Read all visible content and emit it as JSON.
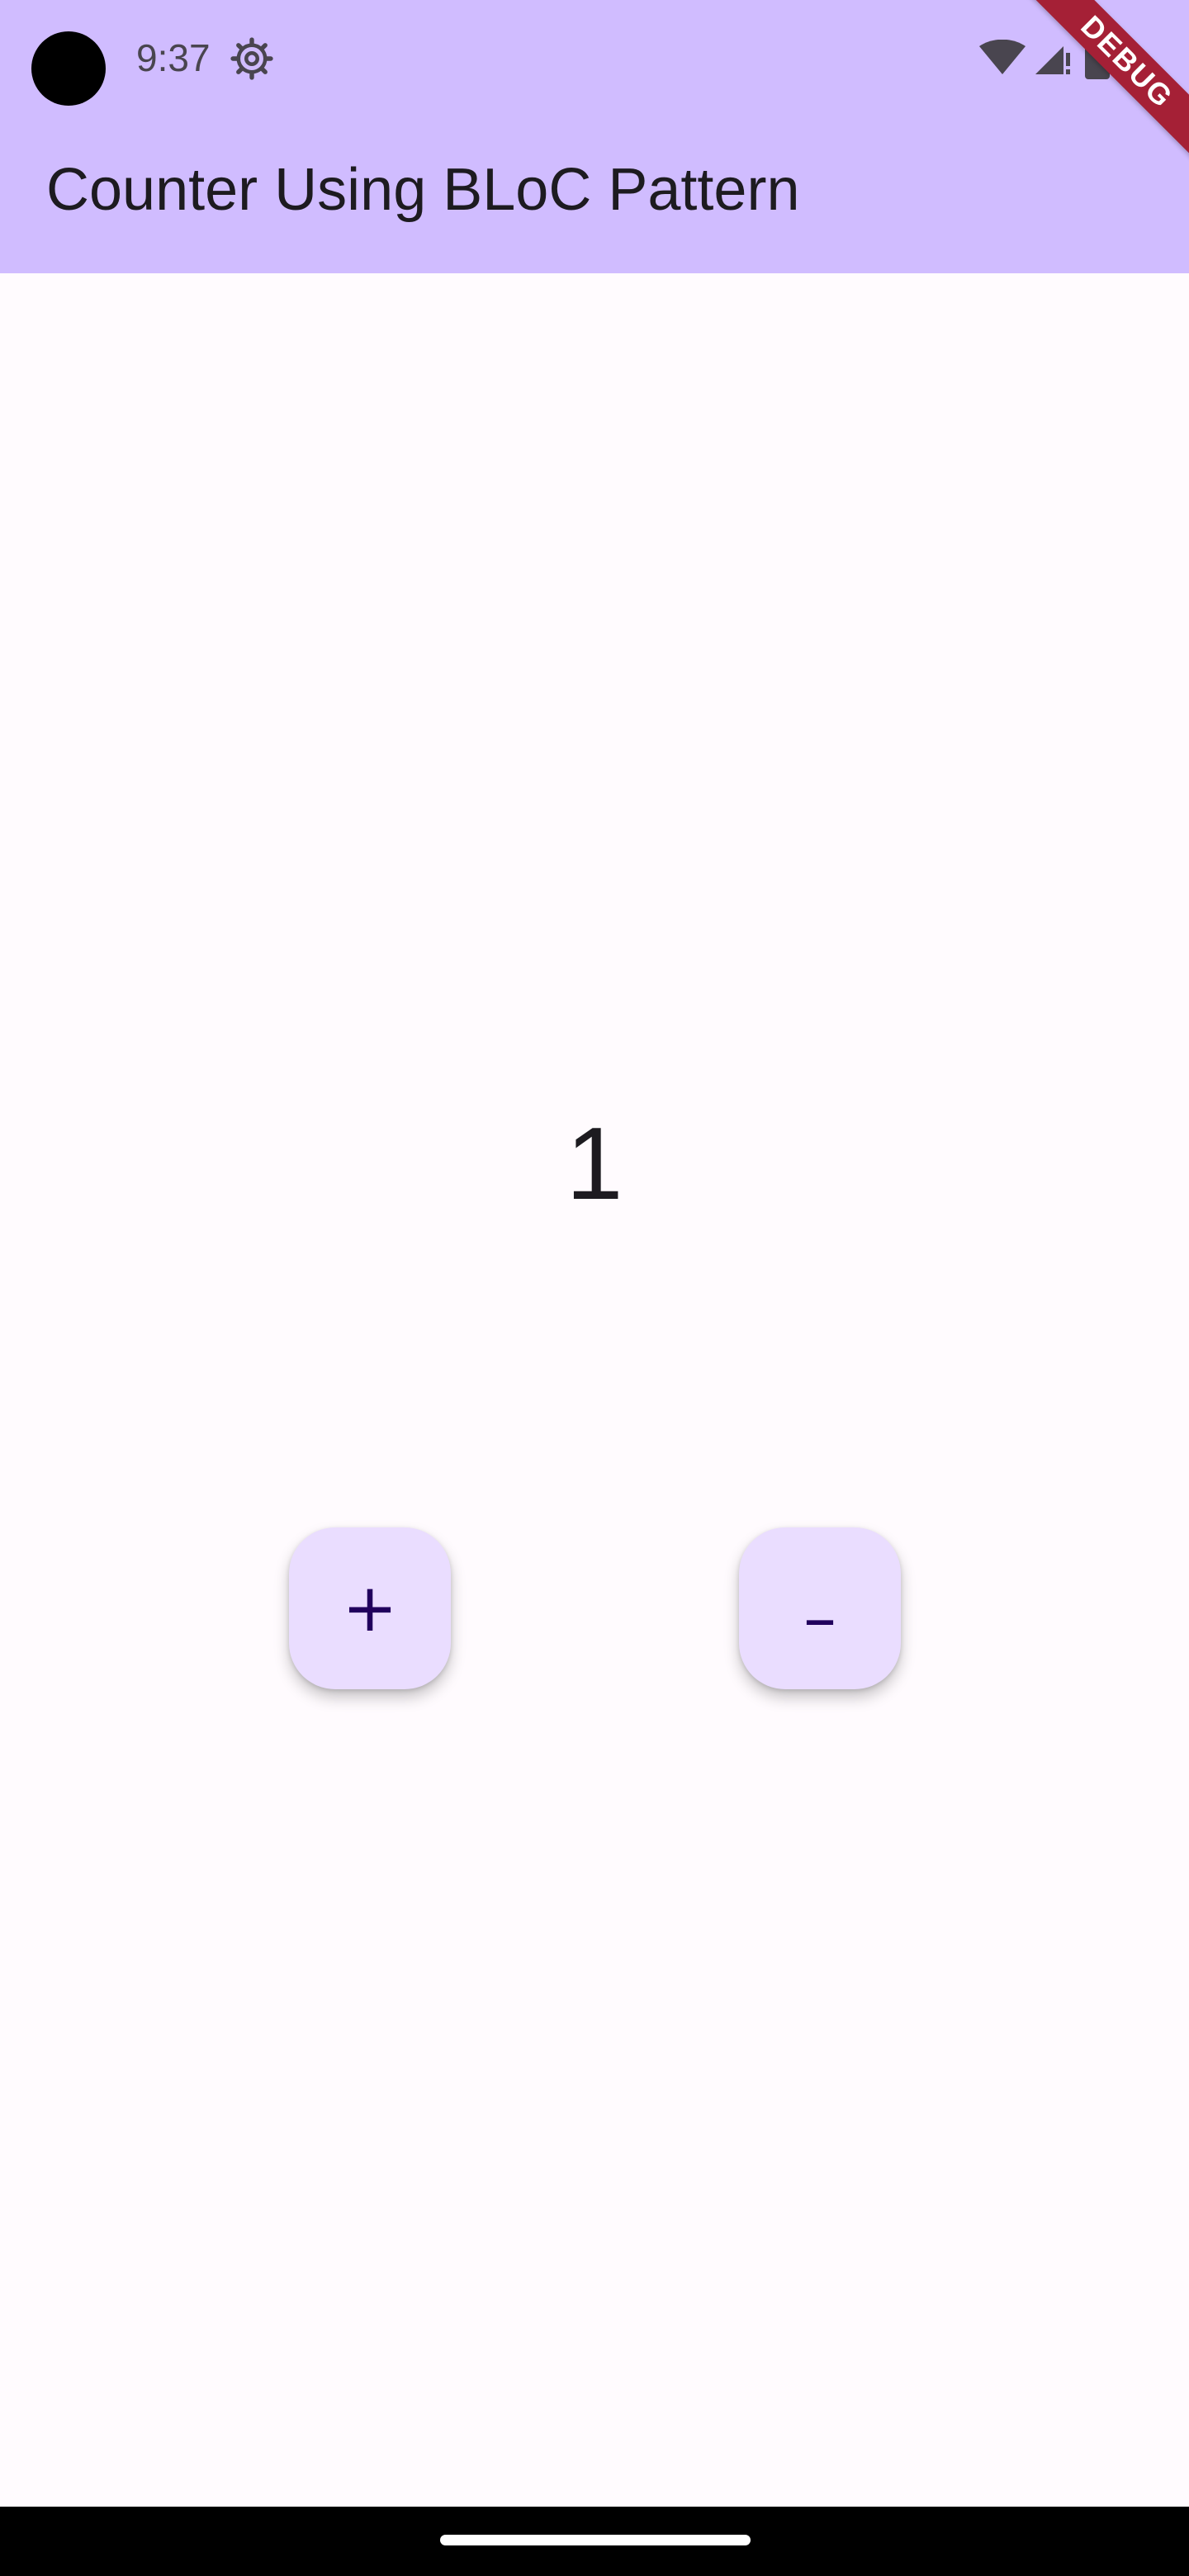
{
  "status_bar": {
    "time": "9:37",
    "icons": [
      "settings-gear-icon",
      "wifi-icon",
      "cellular-signal-icon",
      "battery-icon"
    ]
  },
  "debug_banner": {
    "label": "DEBUG"
  },
  "app_bar": {
    "title": "Counter Using BLoC Pattern"
  },
  "counter": {
    "value": "1"
  },
  "buttons": {
    "increment_label": "+",
    "decrement_label": "–"
  },
  "colors": {
    "app_bar_bg": "#d0bcff",
    "page_bg": "#fffbfe",
    "fab_bg": "#eaddff",
    "fab_fg": "#21005d",
    "debug_banner": "#a52036"
  }
}
